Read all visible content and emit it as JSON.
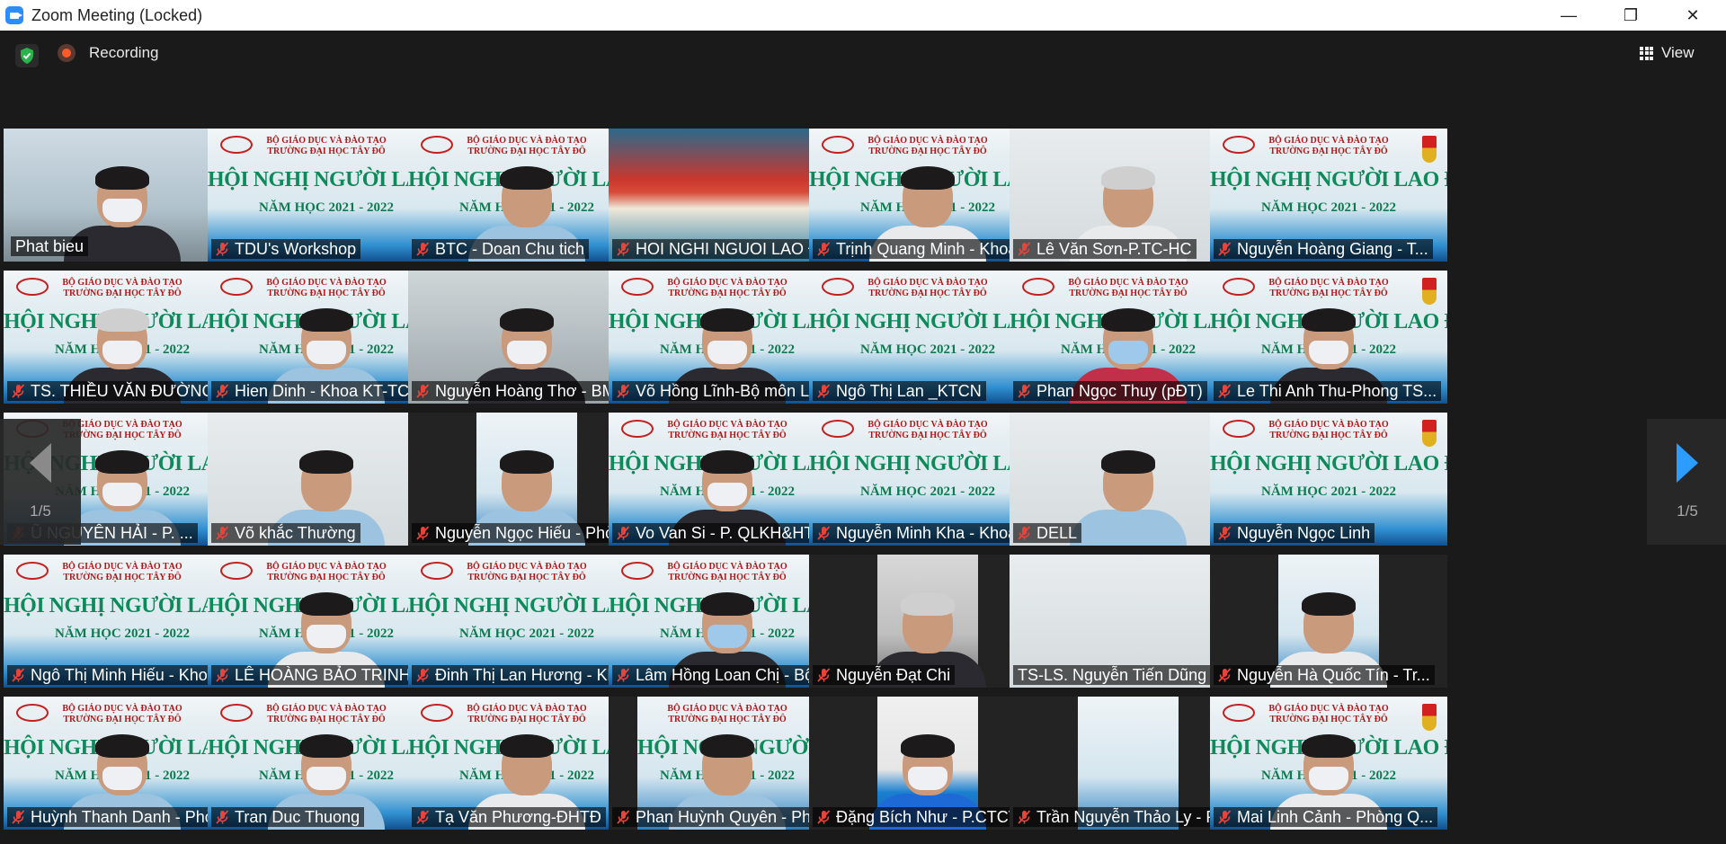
{
  "window": {
    "title": "Zoom Meeting (Locked)",
    "minimize_glyph": "—",
    "maximize_glyph": "❐",
    "close_glyph": "✕"
  },
  "topbar": {
    "security_icon": "shield-check-icon",
    "recording_label": "Recording",
    "view_label": "View"
  },
  "pager": {
    "left_page": "1/5",
    "right_page": "1/5"
  },
  "colors": {
    "active_speaker_border": "#c8ee6a",
    "muted_icon": "#e8443a",
    "zoom_blue": "#2d8cff",
    "background": "#1a1a1a"
  },
  "banner": {
    "line1": "BỘ GIÁO DỤC VÀ ĐÀO TẠO",
    "line2": "TRƯỜNG ĐẠI HỌC TÂY ĐÔ",
    "line3": "HỘI NGHỊ NGƯỜI LAO ĐỘNG",
    "line4": "NĂM HỌC 2021 - 2022"
  },
  "participants": [
    {
      "name": "Phat bieu",
      "muted": false,
      "active": true
    },
    {
      "name": "TDU's Workshop",
      "muted": true
    },
    {
      "name": "BTC - Doan Chu tich",
      "muted": true
    },
    {
      "name": "HOI NGHI NGUOI LAO Đ...",
      "muted": true
    },
    {
      "name": "Trịnh Quang Minh - Khoa...",
      "muted": true
    },
    {
      "name": "Lê Văn Sơn-P.TC-HC",
      "muted": true
    },
    {
      "name": "Nguyễn Hoàng Giang - T...",
      "muted": true
    },
    {
      "name": "TS. THIỀU VĂN ĐƯỜNG - ...",
      "muted": true
    },
    {
      "name": "Hien Dinh - Khoa KT-TC-...",
      "muted": true
    },
    {
      "name": "Nguyễn Hoàng Thơ - BM....",
      "muted": true
    },
    {
      "name": "Võ Hồng Lĩnh-Bộ môn Lu...",
      "muted": true
    },
    {
      "name": "Ngô Thị Lan _KTCN",
      "muted": true
    },
    {
      "name": "Phan Ngọc Thuy (pĐT)",
      "muted": true
    },
    {
      "name": "Le Thi Anh Thu-Phong TS...",
      "muted": true
    },
    {
      "name": "Ũ NGUYÊN HẢI - P. ...",
      "muted": true
    },
    {
      "name": "Võ khắc Thường",
      "muted": true
    },
    {
      "name": "Nguyễn Ngọc Hiếu - Phò...",
      "muted": true
    },
    {
      "name": "Vo Van Si - P. QLKH&HTQT",
      "muted": true
    },
    {
      "name": "Nguyễn Minh Kha - Khoa...",
      "muted": true
    },
    {
      "name": "DELL",
      "muted": true
    },
    {
      "name": "Nguyễn Ngọc Linh",
      "muted": true
    },
    {
      "name": "Ngô Thị Minh Hiếu - Kho...",
      "muted": true
    },
    {
      "name": "LÊ HOÀNG BẢO TRINH - ...",
      "muted": true
    },
    {
      "name": "Đinh Thị Lan Hương - Kh...",
      "muted": true
    },
    {
      "name": "Lâm Hồng Loan Chị - Bộ ...",
      "muted": true
    },
    {
      "name": "Nguyễn Đạt Chi",
      "muted": true
    },
    {
      "name": "TS-LS. Nguyễn Tiến Dũng",
      "muted": false
    },
    {
      "name": "Nguyễn Hà Quốc Tín - Tr...",
      "muted": true
    },
    {
      "name": "Huỳnh Thanh Danh - Phò...",
      "muted": true
    },
    {
      "name": "Tran Duc Thuong",
      "muted": true
    },
    {
      "name": "Tạ Văn Phương-ĐHTĐ",
      "muted": true
    },
    {
      "name": "Phan Huỳnh Quyên - Phò...",
      "muted": true
    },
    {
      "name": "Đặng Bích Như - P.CTCT-...",
      "muted": true
    },
    {
      "name": "Trần Nguyễn Thảo Ly - P...",
      "muted": true
    },
    {
      "name": "Mai Linh Cảnh - Phòng Q...",
      "muted": true
    }
  ]
}
